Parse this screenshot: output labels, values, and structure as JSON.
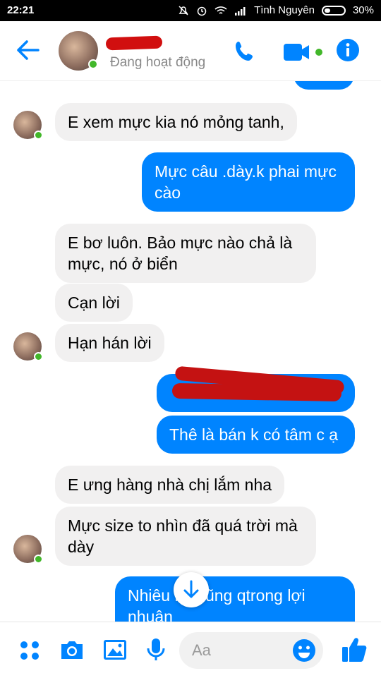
{
  "status_bar": {
    "time": "22:21",
    "carrier": "Tình Nguyên",
    "battery": "30%"
  },
  "header": {
    "contact_status": "Đang hoạt động"
  },
  "messages": [
    {
      "side": "in",
      "text": "E xem mực kia nó mỏng tanh,"
    },
    {
      "side": "out",
      "text": "Mực câu .dày.k phai mực cào"
    },
    {
      "side": "in",
      "text": "E bơ luôn. Bảo mực nào chả là mực, nó ở biển"
    },
    {
      "side": "in",
      "text": "Cạn lời"
    },
    {
      "side": "in",
      "text": "Hạn hán lời"
    },
    {
      "side": "out",
      "text": "Thê là bán k có tâm c ạ"
    },
    {
      "side": "in",
      "text": "E ưng hàng nhà chị lắm nha"
    },
    {
      "side": "in",
      "text": "Mực size to nhìn đã quá trời mà dày"
    },
    {
      "side": "out",
      "text": "Nhiêu         họ cũng qtrong lợi nhuận"
    }
  ],
  "composer": {
    "placeholder": "Aa"
  },
  "colors": {
    "accent": "#0084ff",
    "incoming": "#f1f0f0",
    "online": "#42b72a",
    "redaction": "#c41212"
  },
  "icons": [
    "back-arrow-icon",
    "phone-icon",
    "video-icon",
    "info-icon",
    "apps-icon",
    "camera-icon",
    "gallery-icon",
    "mic-icon",
    "emoji-icon",
    "like-icon",
    "arrow-down-icon"
  ]
}
